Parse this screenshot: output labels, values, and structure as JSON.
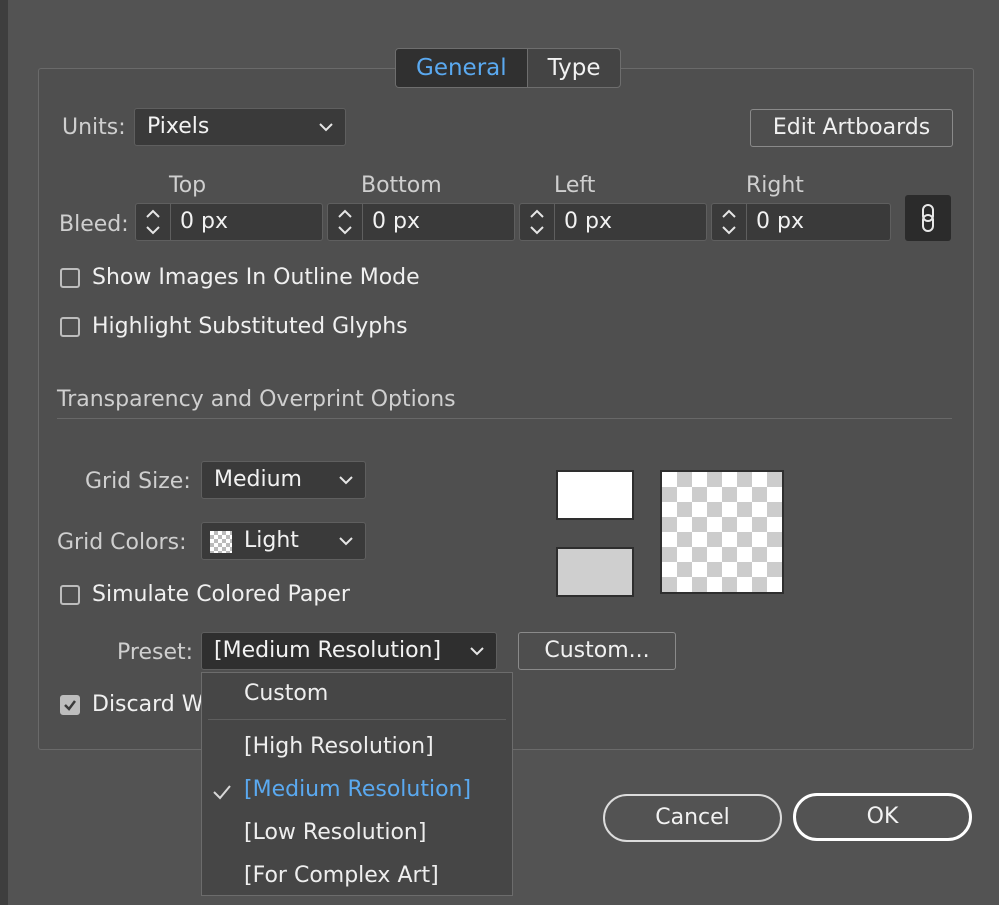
{
  "tabs": [
    {
      "label": "General",
      "active": true
    },
    {
      "label": "Type",
      "active": false
    }
  ],
  "units": {
    "label": "Units:",
    "value": "Pixels"
  },
  "edit_artboards_label": "Edit Artboards",
  "bleed": {
    "label": "Bleed:",
    "fields": [
      {
        "label": "Top",
        "value": "0 px"
      },
      {
        "label": "Bottom",
        "value": "0 px"
      },
      {
        "label": "Left",
        "value": "0 px"
      },
      {
        "label": "Right",
        "value": "0 px"
      }
    ]
  },
  "checkboxes": {
    "show_images": {
      "label": "Show Images In Outline Mode",
      "checked": false
    },
    "highlight_glyphs": {
      "label": "Highlight Substituted Glyphs",
      "checked": false
    },
    "simulate_paper": {
      "label": "Simulate Colored Paper",
      "checked": false
    },
    "discard": {
      "label": "Discard W",
      "checked": true
    }
  },
  "transparency": {
    "heading": "Transparency and Overprint Options",
    "grid_size": {
      "label": "Grid Size:",
      "value": "Medium"
    },
    "grid_colors": {
      "label": "Grid Colors:",
      "value": "Light"
    }
  },
  "preset": {
    "label": "Preset:",
    "value": "[Medium Resolution]",
    "custom_button": "Custom...",
    "menu": [
      {
        "label": "Custom",
        "selected": false
      },
      {
        "label": "[High Resolution]",
        "selected": false
      },
      {
        "label": "[Medium Resolution]",
        "selected": true
      },
      {
        "label": "[Low Resolution]",
        "selected": false
      },
      {
        "label": "[For Complex Art]",
        "selected": false
      }
    ]
  },
  "footer": {
    "cancel": "Cancel",
    "ok": "OK"
  },
  "colors": {
    "accent": "#5aa9f0",
    "background": "#535353",
    "field": "#3a3a3a"
  }
}
